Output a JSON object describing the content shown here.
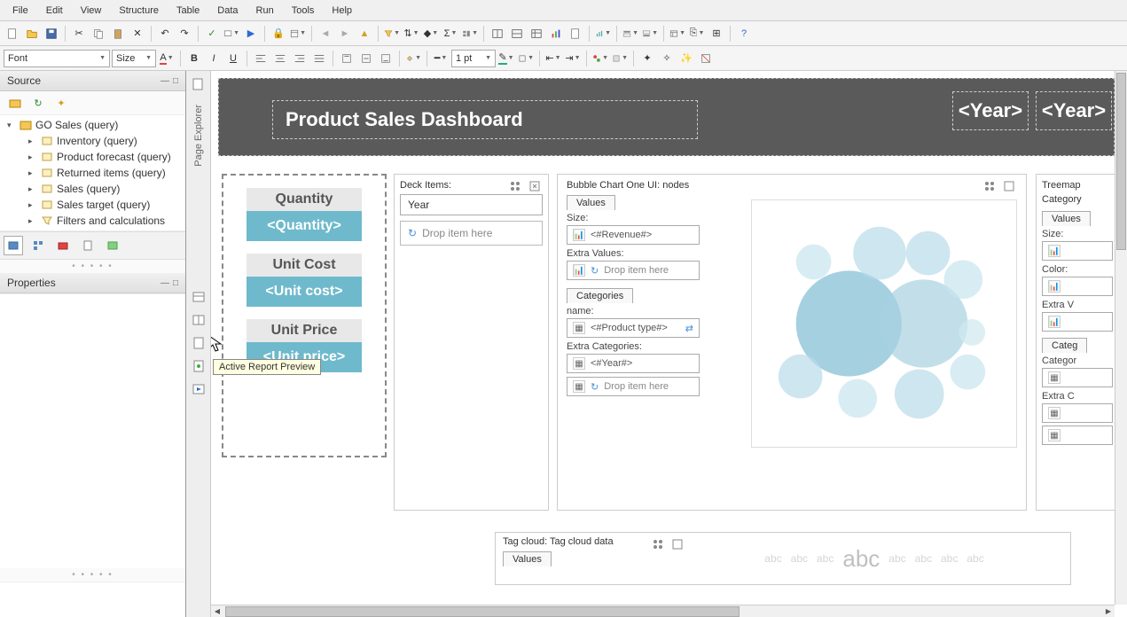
{
  "menu": {
    "items": [
      "File",
      "Edit",
      "View",
      "Structure",
      "Table",
      "Data",
      "Run",
      "Tools",
      "Help"
    ]
  },
  "toolbar2": {
    "font_placeholder": "Font",
    "size_placeholder": "Size",
    "pt_value": "1 pt"
  },
  "source": {
    "title": "Source",
    "root": "GO Sales (query)",
    "children": [
      "Inventory (query)",
      "Product forecast (query)",
      "Returned items (query)",
      "Sales (query)",
      "Sales target (query)",
      "Filters and calculations"
    ]
  },
  "properties": {
    "title": "Properties"
  },
  "vstrip": {
    "label": "Page Explorer"
  },
  "tooltip": "Active Report Preview",
  "dashboard": {
    "title": "Product Sales Dashboard",
    "year_placeholder": "<Year>"
  },
  "stats": [
    {
      "label": "Quantity",
      "value": "<Quantity>"
    },
    {
      "label": "Unit Cost",
      "value": "<Unit cost>"
    },
    {
      "label": "Unit Price",
      "value": "<Unit price>"
    }
  ],
  "deck": {
    "title": "Deck Items:",
    "field": "Year",
    "drop": "Drop item here"
  },
  "bubble": {
    "title": "Bubble Chart One UI: nodes",
    "values_tab": "Values",
    "size_label": "Size:",
    "size_value": "<#Revenue#>",
    "extra_values_label": "Extra Values:",
    "drop": "Drop item here",
    "categories_tab": "Categories",
    "name_label": "name:",
    "name_value": "<#Product type#>",
    "extra_cat_label": "Extra Categories:",
    "extra_cat_value": "<#Year#>"
  },
  "treemap": {
    "title": "Treemap",
    "subtitle": "Category",
    "values_tab": "Values",
    "size_label": "Size:",
    "color_label": "Color:",
    "extra_v_label": "Extra V",
    "cat_tab": "Categ",
    "cat_label": "Categor",
    "extra_c_label": "Extra C"
  },
  "tagcloud": {
    "title": "Tag cloud: Tag cloud data",
    "values_tab": "Values",
    "word": "abc"
  }
}
